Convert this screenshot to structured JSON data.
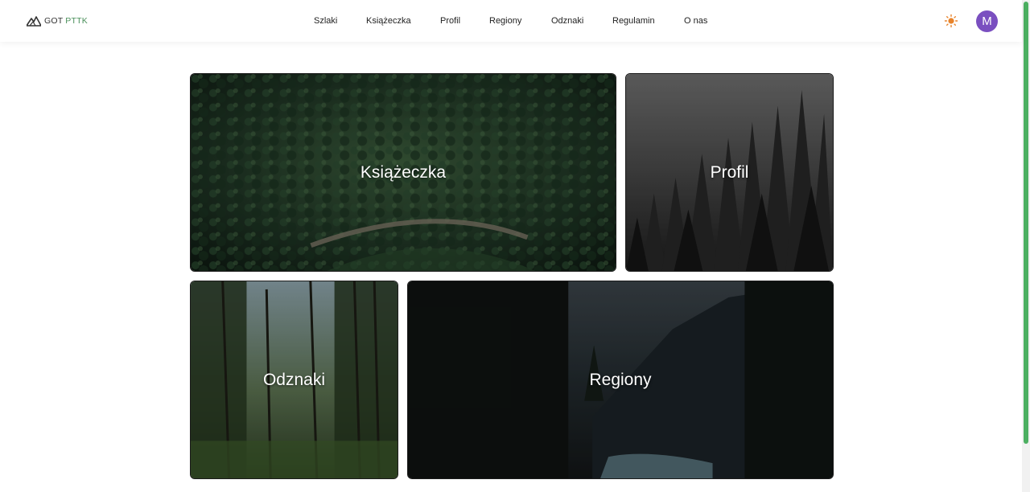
{
  "brand": {
    "name_part1": "GOT",
    "name_part2": "PTTK"
  },
  "nav": {
    "links": [
      "Szlaki",
      "Książeczka",
      "Profil",
      "Regiony",
      "Odznaki",
      "Regulamin",
      "O nas"
    ]
  },
  "user": {
    "avatar_initial": "M"
  },
  "tiles": {
    "ksiazeczka": "Książeczka",
    "profil": "Profil",
    "odznaki": "Odznaki",
    "regiony": "Regiony"
  },
  "colors": {
    "accent_green": "#4caf61",
    "avatar_purple": "#7a4fc0",
    "sun_orange": "#e8832a"
  },
  "icons": {
    "logo": "mountain-logo-icon",
    "theme": "sun-icon"
  }
}
